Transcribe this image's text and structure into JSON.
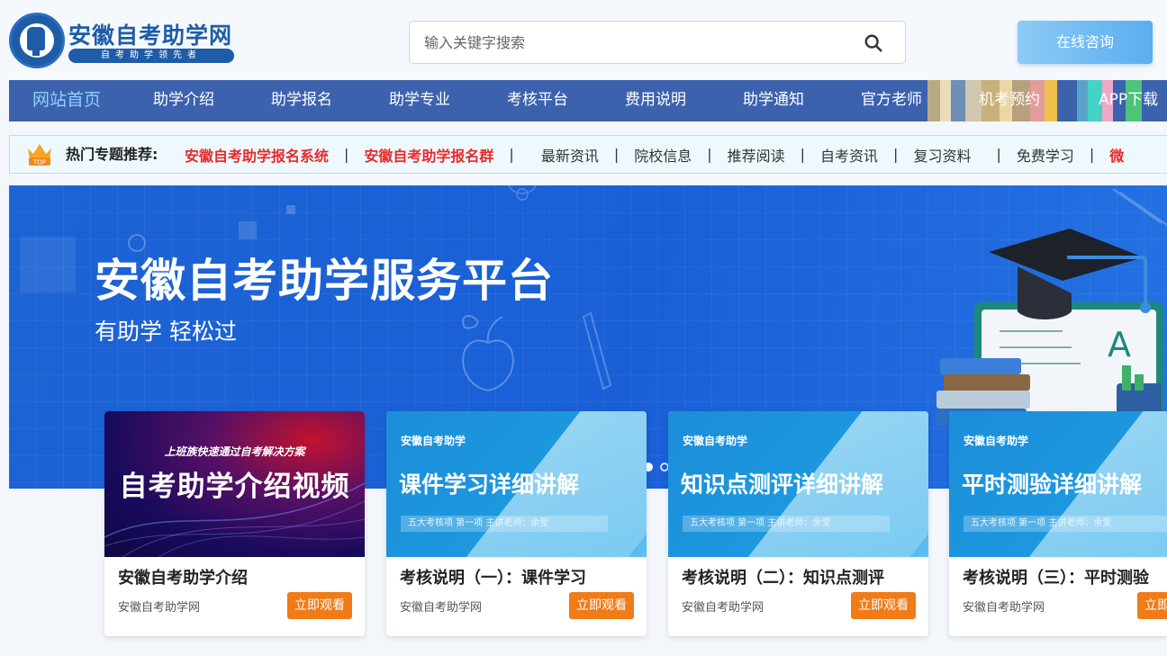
{
  "header": {
    "brand_title": "安徽自考助学网",
    "brand_sub": "自考助学领先者",
    "search_placeholder": "输入关键字搜索",
    "consult_label": "在线咨询"
  },
  "nav": {
    "items": [
      {
        "label": "网站首页",
        "active": true
      },
      {
        "label": "助学介绍"
      },
      {
        "label": "助学报名"
      },
      {
        "label": "助学专业"
      },
      {
        "label": "考核平台"
      },
      {
        "label": "费用说明"
      },
      {
        "label": "助学通知"
      },
      {
        "label": "官方老师"
      },
      {
        "label": "机考预约"
      },
      {
        "label": "APP下载"
      }
    ]
  },
  "hotbar": {
    "badge": "TOP",
    "label": "热门专题推荐:",
    "links": [
      {
        "label": "安徽自考助学报名系统",
        "highlight": true
      },
      {
        "label": "安徽自考助学报名群",
        "highlight": true
      },
      {
        "label": "最新资讯"
      },
      {
        "label": "院校信息"
      },
      {
        "label": "推荐阅读"
      },
      {
        "label": "自考资讯"
      },
      {
        "label": "复习资料"
      },
      {
        "label": "免费学习"
      },
      {
        "label": "微",
        "highlight": true
      }
    ],
    "separator": "|"
  },
  "banner": {
    "title": "安徽自考助学服务平台",
    "subtitle": "有助学 轻松过",
    "slides_total": 2,
    "slide_active": 1
  },
  "cards": [
    {
      "type": "video",
      "thumb_top": "上班族快速通过自考解决方案",
      "thumb_main": "自考助学介绍视频",
      "title": "安徽自考助学介绍",
      "source": "安徽自考助学网",
      "button": "立即观看"
    },
    {
      "type": "lecture",
      "kicker": "安徽自考助学",
      "headline": "课件学习详细讲解",
      "tagline": "五大考核项   第一项   主讲老师：余莹",
      "title": "考核说明（一）：课件学习",
      "source": "安徽自考助学网",
      "button": "立即观看"
    },
    {
      "type": "lecture",
      "kicker": "安徽自考助学",
      "headline": "知识点测评详细讲解",
      "tagline": "五大考核项   第一项   主讲老师：余莹",
      "title": "考核说明（二）：知识点测评",
      "source": "安徽自考助学网",
      "button": "立即观看"
    },
    {
      "type": "lecture",
      "kicker": "安徽自考助学",
      "headline": "平时测验详细讲解",
      "tagline": "五大考核项   第一项   主讲老师：余莹",
      "title": "考核说明（三）：平时测验",
      "source": "安徽自考助学网",
      "button": "立即观看"
    }
  ],
  "colors": {
    "brand": "#1f5ca8",
    "nav_bg": "#3c62ae",
    "nav_active": "#8fd0ff",
    "hot_red": "#e62b2b",
    "watch_button": "#f07b17",
    "banner_blue": "#1a5fd6"
  },
  "icons": [
    "logo-emblem",
    "search-icon",
    "crown-icon",
    "graduation-cap-icon",
    "book-icon",
    "apple-icon",
    "pencil-icon"
  ]
}
